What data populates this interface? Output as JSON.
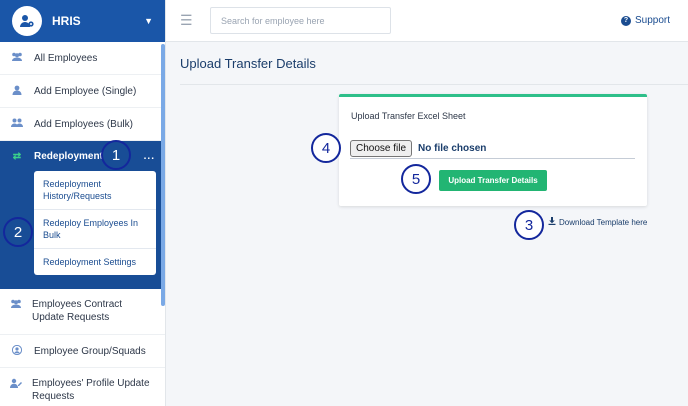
{
  "sidebar": {
    "brand": {
      "title": "HRIS",
      "icon": "user-cog-icon"
    },
    "items": [
      {
        "label": "All Employees",
        "icon": "users-icon"
      },
      {
        "label": "Add Employee (Single)",
        "icon": "user-icon"
      },
      {
        "label": "Add Employees (Bulk)",
        "icon": "users-icon"
      }
    ],
    "active": {
      "label": "Redeployment",
      "icon": "swap-arrows-icon",
      "more": "...",
      "submenu": [
        {
          "label": "Redeployment History/Requests"
        },
        {
          "label": "Redeploy Employees In Bulk"
        },
        {
          "label": "Redeployment Settings"
        }
      ]
    },
    "items_after": [
      {
        "label": "Employees Contract Update Requests",
        "icon": "users-icon"
      },
      {
        "label": "Employee Group/Squads",
        "icon": "user-circle-icon"
      },
      {
        "label": "Employees' Profile Update Requests",
        "icon": "user-edit-icon"
      }
    ]
  },
  "topbar": {
    "search_placeholder": "Search for employee here",
    "support_label": "Support"
  },
  "main": {
    "title": "Upload Transfer Details",
    "card": {
      "label": "Upload Transfer Excel Sheet",
      "choose_file_label": "Choose file",
      "no_file_label": "No file chosen",
      "upload_button": "Upload Transfer Details"
    },
    "download_link": "Download Template here"
  },
  "steps": [
    "1",
    "2",
    "3",
    "4",
    "5"
  ],
  "colors": {
    "brand_blue": "#1a56a8",
    "active_bg": "#184d96",
    "accent_green": "#22b573",
    "step_ring": "#13279c"
  }
}
